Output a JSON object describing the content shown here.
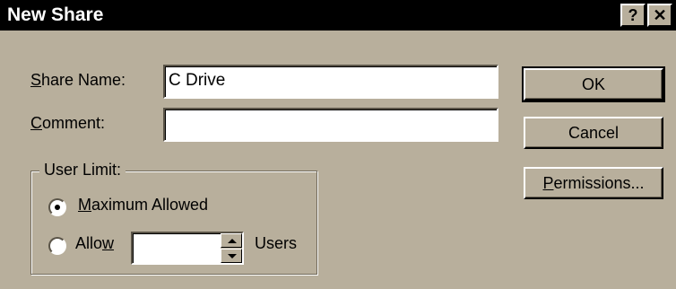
{
  "window": {
    "title": "New Share",
    "help_button": "?",
    "close_button": "✕"
  },
  "form": {
    "share_name": {
      "label_ul": "S",
      "label_rest": "hare Name:",
      "value": "C Drive"
    },
    "comment": {
      "label_ul": "C",
      "label_rest": "omment:",
      "value": ""
    }
  },
  "user_limit": {
    "legend": "User Limit:",
    "maximum": {
      "label_ul": "M",
      "label_rest": "aximum Allowed",
      "selected": true
    },
    "allow": {
      "label_pre": "Allo",
      "label_ul": "w",
      "value": "",
      "suffix": "Users",
      "selected": false
    }
  },
  "buttons": {
    "ok": "OK",
    "cancel": "Cancel",
    "permissions_ul": "P",
    "permissions_rest": "ermissions..."
  }
}
